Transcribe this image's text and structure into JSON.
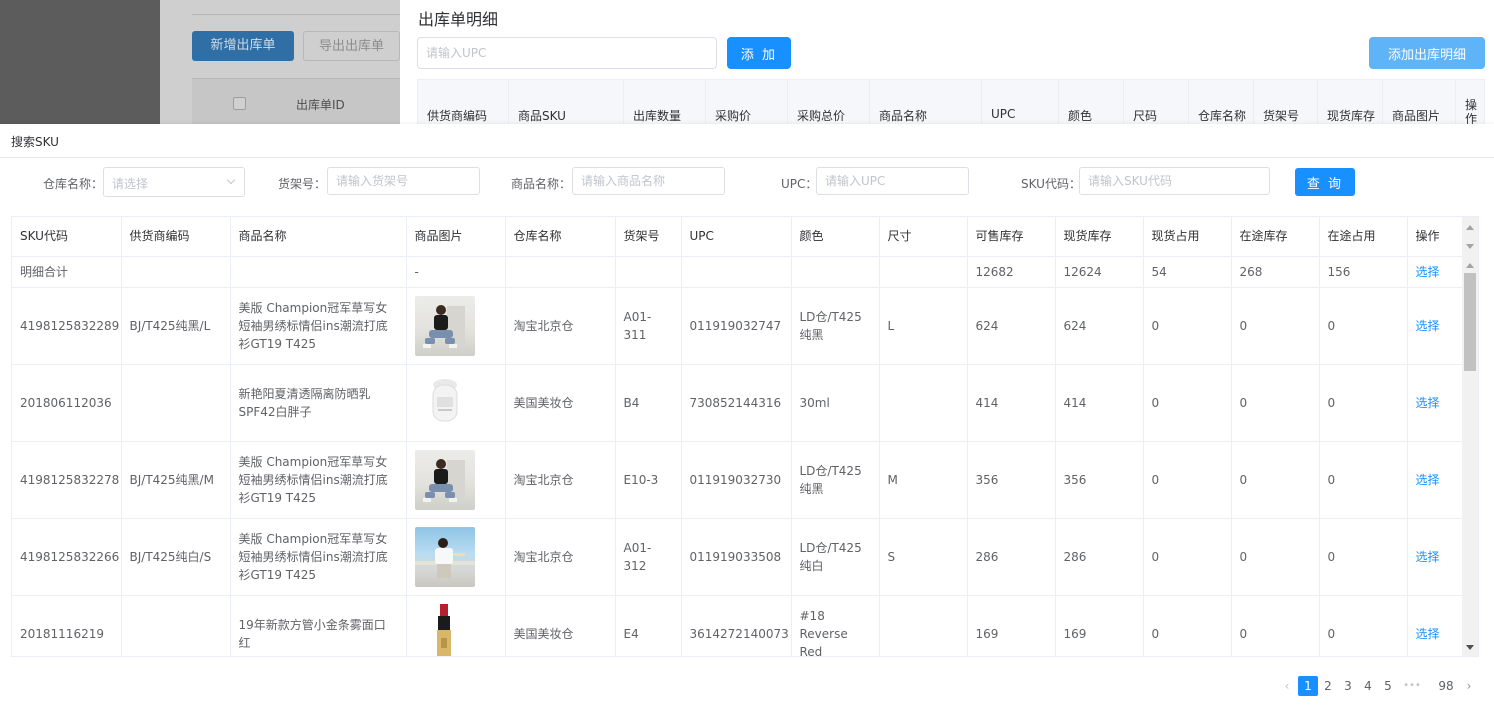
{
  "background_page": {
    "add_button": "新增出库单",
    "export_button": "导出出库单",
    "id_column": "出库单ID"
  },
  "detail_drawer": {
    "title": "出库单明细",
    "upc_placeholder": "请输入UPC",
    "add_button": "添 加",
    "add_detail_button": "添加出库明细",
    "columns": [
      "供货商编码",
      "商品SKU",
      "出库数量",
      "采购价",
      "采购总价",
      "商品名称",
      "UPC",
      "颜色",
      "尺码",
      "仓库名称",
      "货架号",
      "现货库存",
      "商品图片",
      "操作"
    ]
  },
  "search_modal": {
    "title": "搜索SKU",
    "filters": {
      "warehouse_label": "仓库名称：",
      "warehouse_placeholder": "请选择",
      "shelf_label": "货架号：",
      "shelf_placeholder": "请输入货架号",
      "product_label": "商品名称：",
      "product_placeholder": "请输入商品名称",
      "upc_label": "UPC：",
      "upc_placeholder": "请输入UPC",
      "sku_label": "SKU代码：",
      "sku_placeholder": "请输入SKU代码",
      "query_button": "查 询"
    },
    "table": {
      "columns": [
        "SKU代码",
        "供货商编码",
        "商品名称",
        "商品图片",
        "仓库名称",
        "货架号",
        "UPC",
        "颜色",
        "尺寸",
        "可售库存",
        "现货库存",
        "现货占用",
        "在途库存",
        "在途占用",
        "操作"
      ],
      "summary": {
        "label": "明细合计",
        "image": "-",
        "sellable": "12682",
        "on_hand": "12624",
        "on_hand_reserved": "54",
        "in_transit": "268",
        "in_transit_reserved": "156",
        "action": "选择"
      },
      "rows": [
        {
          "sku": "4198125832289",
          "supplier": "BJ/T425纯黑/L",
          "name": "美版 Champion冠军草写女短袖男绣标情侣ins潮流打底衫GT19 T425",
          "image_icon": "model-photo-black-tee",
          "warehouse": "淘宝北京仓",
          "shelf": "A01-311",
          "upc": "011919032747",
          "color": "LD仓/T425纯黑",
          "size": "L",
          "sellable": "624",
          "on_hand": "624",
          "on_hand_reserved": "0",
          "in_transit": "0",
          "in_transit_reserved": "0",
          "action": "选择"
        },
        {
          "sku": "201806112036",
          "supplier": "",
          "name": "新艳阳夏清透隔离防晒乳SPF42白胖子",
          "image_icon": "sunscreen-bottle",
          "warehouse": "美国美妆仓",
          "shelf": "B4",
          "upc": "730852144316",
          "color": "30ml",
          "size": "",
          "sellable": "414",
          "on_hand": "414",
          "on_hand_reserved": "0",
          "in_transit": "0",
          "in_transit_reserved": "0",
          "action": "选择"
        },
        {
          "sku": "4198125832278",
          "supplier": "BJ/T425纯黑/M",
          "name": "美版 Champion冠军草写女短袖男绣标情侣ins潮流打底衫GT19 T425",
          "image_icon": "model-photo-black-tee",
          "warehouse": "淘宝北京仓",
          "shelf": "E10-3",
          "upc": "011919032730",
          "color": "LD仓/T425纯黑",
          "size": "M",
          "sellable": "356",
          "on_hand": "356",
          "on_hand_reserved": "0",
          "in_transit": "0",
          "in_transit_reserved": "0",
          "action": "选择"
        },
        {
          "sku": "4198125832266",
          "supplier": "BJ/T425纯白/S",
          "name": "美版 Champion冠军草写女短袖男绣标情侣ins潮流打底衫GT19 T425",
          "image_icon": "model-photo-white-tee",
          "warehouse": "淘宝北京仓",
          "shelf": "A01-312",
          "upc": "011919033508",
          "color": "LD仓/T425纯白",
          "size": "S",
          "sellable": "286",
          "on_hand": "286",
          "on_hand_reserved": "0",
          "in_transit": "0",
          "in_transit_reserved": "0",
          "action": "选择"
        },
        {
          "sku": "20181116219",
          "supplier": "",
          "name": "19年新款方管小金条雾面口红",
          "image_icon": "lipstick-tube",
          "warehouse": "美国美妆仓",
          "shelf": "E4",
          "upc": "3614272140073",
          "color": "#18 Reverse Red",
          "size": "",
          "sellable": "169",
          "on_hand": "169",
          "on_hand_reserved": "0",
          "in_transit": "0",
          "in_transit_reserved": "0",
          "action": "选择"
        }
      ]
    },
    "pagination": {
      "pages": [
        "1",
        "2",
        "3",
        "4",
        "5"
      ],
      "ellipsis": "•••",
      "last": "98",
      "current": "1"
    }
  },
  "colors": {
    "primary": "#1890ff",
    "primary_light": "#5fb3f7",
    "overlay_dark": "#5c5c5c",
    "border": "#ebeef5"
  }
}
